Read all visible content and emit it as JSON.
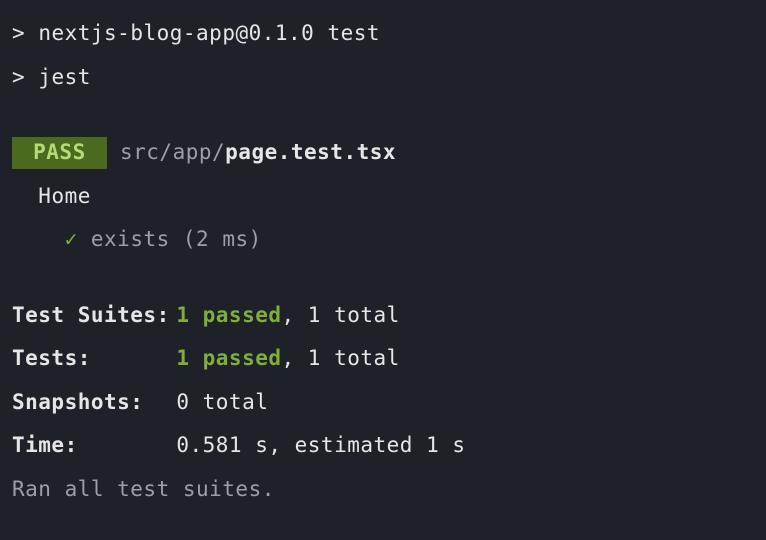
{
  "cmd": {
    "prompt": ">",
    "line1": "nextjs-blog-app@0.1.0 test",
    "line2": "jest"
  },
  "result": {
    "badge": " PASS ",
    "dir": " src/app/",
    "file": "page.test.tsx",
    "describe": "Home",
    "check": "✓",
    "test_name": "exists",
    "test_time": "(2 ms)"
  },
  "summary": {
    "suites_label": "Test Suites:",
    "suites_passed": "1 passed",
    "suites_total": ", 1 total",
    "tests_label": "Tests:",
    "tests_passed": "1 passed",
    "tests_total": ", 1 total",
    "snapshots_label": "Snapshots:",
    "snapshots_value": "0 total",
    "time_label": "Time:",
    "time_value": "0.581 s, estimated 1 s",
    "footer": "Ran all test suites."
  }
}
